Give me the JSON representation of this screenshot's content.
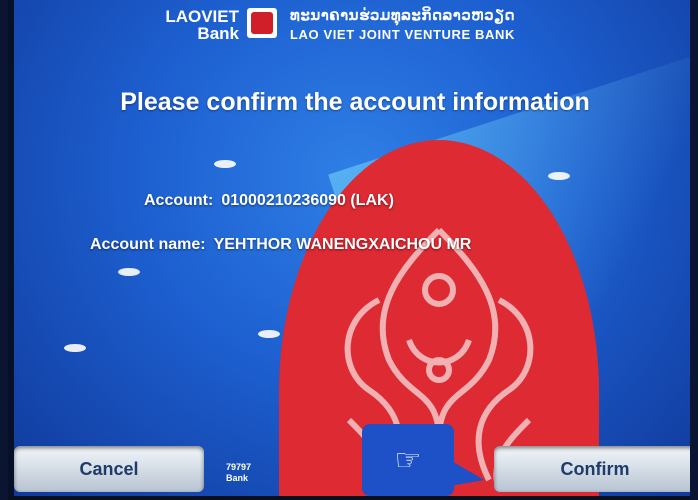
{
  "header": {
    "bank_name_line1": "LAOVIET",
    "bank_name_line2": "Bank",
    "bank_name_lao": "ທະນາຄານຮ່ວມທຸລະກິດລາວຫວຽດ",
    "bank_full_name": "LAO VIET JOINT VENTURE BANK"
  },
  "screen": {
    "title": "Please confirm the account information"
  },
  "account": {
    "account_label": "Account:",
    "account_value": "01000210236090 (LAK)",
    "name_label": "Account name:",
    "name_value": "YEHTHOR WANENGXAICHOU MR"
  },
  "buttons": {
    "cancel": "Cancel",
    "confirm": "Confirm"
  },
  "footer": {
    "fragment_line1": "79797",
    "fragment_line2": "Bank"
  },
  "colors": {
    "background": "#1d5fd0",
    "petal": "#dd2a33",
    "button_text": "#1f3b6a"
  },
  "icons": {
    "pointer": "hand-pointing-icon"
  }
}
